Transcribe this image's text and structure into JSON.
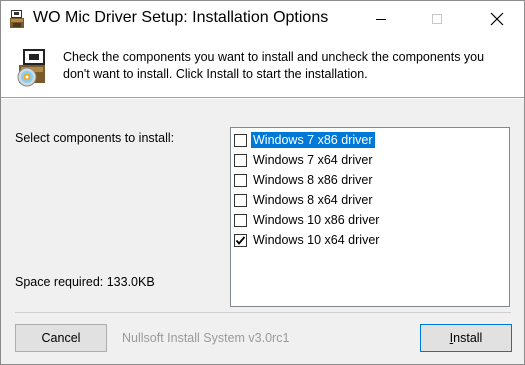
{
  "window": {
    "title": "WO Mic Driver Setup: Installation Options"
  },
  "header": {
    "description": "Check the components you want to install and uncheck the components you don't want to install. Click Install to start the installation."
  },
  "body": {
    "select_label": "Select components to install:",
    "space_required": "Space required: 133.0KB",
    "components": [
      {
        "label": "Windows 7 x86 driver",
        "checked": false,
        "selected": true
      },
      {
        "label": "Windows 7 x64 driver",
        "checked": false,
        "selected": false
      },
      {
        "label": "Windows 8 x86 driver",
        "checked": false,
        "selected": false
      },
      {
        "label": "Windows 8 x64 driver",
        "checked": false,
        "selected": false
      },
      {
        "label": "Windows 10 x86 driver",
        "checked": false,
        "selected": false
      },
      {
        "label": "Windows 10 x64 driver",
        "checked": true,
        "selected": false
      }
    ]
  },
  "footer": {
    "cancel_label": "Cancel",
    "brand": "Nullsoft Install System v3.0rc1",
    "install_label": "Install",
    "install_accel_char": "I",
    "install_rest": "nstall"
  },
  "colors": {
    "selection": "#0078d7",
    "dialog_bg": "#f0f0f0"
  },
  "icons": {
    "app": "installer-box-icon",
    "header": "installer-disc-icon",
    "minimize": "minimize-icon",
    "maximize": "maximize-icon",
    "close": "close-icon",
    "check": "checkmark-icon"
  }
}
